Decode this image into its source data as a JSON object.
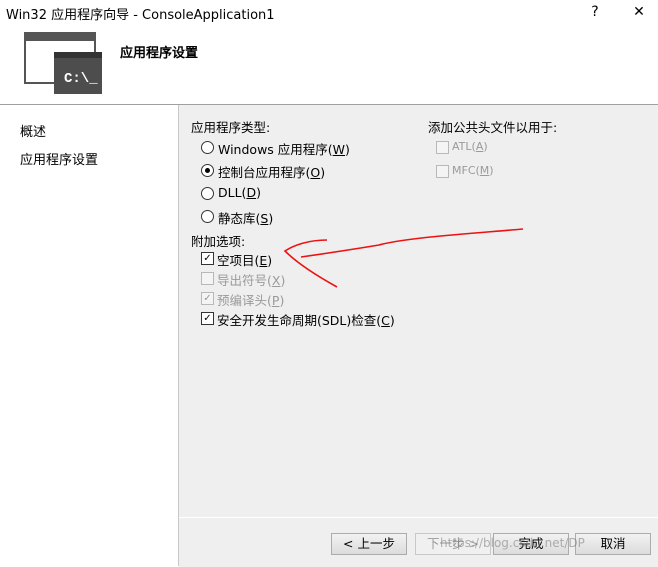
{
  "window": {
    "title": "Win32 应用程序向导 - ConsoleApplication1",
    "help_label": "?",
    "close_label": "✕"
  },
  "header": {
    "title": "应用程序设置",
    "icon_text": "C:\\_"
  },
  "sidebar": {
    "items": [
      {
        "label": "概述"
      },
      {
        "label": "应用程序设置"
      }
    ]
  },
  "app_type": {
    "label": "应用程序类型:",
    "options": [
      {
        "text": "Windows 应用程序(",
        "key": "W",
        "end": ")",
        "selected": false
      },
      {
        "text": "控制台应用程序(",
        "key": "O",
        "end": ")",
        "selected": true
      },
      {
        "text": "DLL(",
        "key": "D",
        "end": ")",
        "selected": false
      },
      {
        "text": "静态库(",
        "key": "S",
        "end": ")",
        "selected": false
      }
    ]
  },
  "common_headers": {
    "label": "添加公共头文件以用于:",
    "options": [
      {
        "text": "ATL(",
        "key": "A",
        "end": ")",
        "checked": false,
        "enabled": false
      },
      {
        "text": "MFC(",
        "key": "M",
        "end": ")",
        "checked": false,
        "enabled": false
      }
    ]
  },
  "additional": {
    "label": "附加选项:",
    "options": [
      {
        "text": "空项目(",
        "key": "E",
        "end": ")",
        "checked": true,
        "enabled": true
      },
      {
        "text": "导出符号(",
        "key": "X",
        "end": ")",
        "checked": false,
        "enabled": false
      },
      {
        "text": "预编译头(",
        "key": "P",
        "end": ")",
        "checked": true,
        "enabled": false
      },
      {
        "text": "安全开发生命周期(SDL)检查(",
        "key": "C",
        "end": ")",
        "checked": true,
        "enabled": true
      }
    ]
  },
  "buttons": {
    "prev": "< 上一步",
    "next": "下一步 >",
    "finish": "完成",
    "cancel": "取消"
  },
  "watermark": "https://blog.csdn.net/DP"
}
